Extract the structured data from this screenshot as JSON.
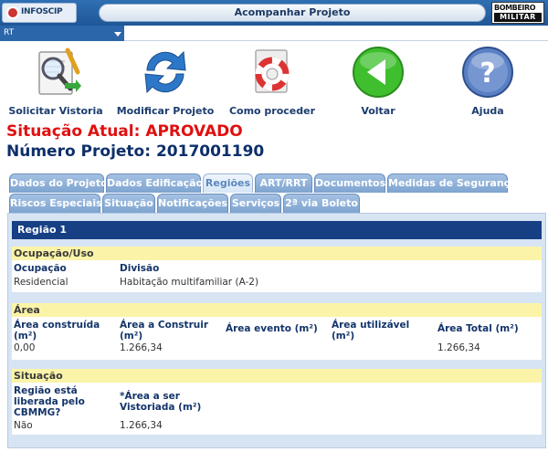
{
  "header": {
    "title": "Acompanhar Projeto",
    "logo_left": "INFOSCIP",
    "logo_right_top": "BOMBEIRO",
    "logo_right_bottom": "MILITAR"
  },
  "selector": {
    "value": "RT"
  },
  "toolbar": [
    {
      "label": "Solicitar Vistoria",
      "icon": "inspection-icon"
    },
    {
      "label": "Modificar Projeto",
      "icon": "refresh-arrows-icon"
    },
    {
      "label": "Como proceder",
      "icon": "lifebuoy-icon"
    },
    {
      "label": "Voltar",
      "icon": "back-arrow-icon"
    },
    {
      "label": "Ajuda",
      "icon": "help-icon"
    }
  ],
  "status": {
    "text": "Situação Atual: APROVADO"
  },
  "project": {
    "text": "Número Projeto: 2017001190"
  },
  "tabs_row1": [
    {
      "label": "Dados do Projeto",
      "active": false
    },
    {
      "label": "Dados Edificação",
      "active": false
    },
    {
      "label": "Regiões",
      "active": true
    },
    {
      "label": "ART/RRT",
      "active": false
    },
    {
      "label": "Documentos",
      "active": false
    },
    {
      "label": "Medidas de Segurança",
      "active": false
    }
  ],
  "tabs_row2": [
    {
      "label": "Riscos Especiais",
      "active": false
    },
    {
      "label": "Situação",
      "active": false
    },
    {
      "label": "Notificações",
      "active": false
    },
    {
      "label": "Serviços",
      "active": false
    },
    {
      "label": "2ª via Boleto",
      "active": false
    }
  ],
  "region": {
    "title": "Região 1",
    "ocupacao": {
      "heading": "Ocupação/Uso",
      "fields": [
        {
          "label": "Ocupação",
          "value": "Residencial"
        },
        {
          "label": "Divisão",
          "value": "Habitação multifamiliar (A-2)"
        }
      ]
    },
    "area": {
      "heading": "Área",
      "fields": [
        {
          "label": "Área construída (m²)",
          "value": "0,00"
        },
        {
          "label": "Área a Construir (m²)",
          "value": "1.266,34"
        },
        {
          "label": "Área evento (m²)",
          "value": ""
        },
        {
          "label": "Área utilizável (m²)",
          "value": ""
        },
        {
          "label": "Área Total (m²)",
          "value": "1.266,34"
        }
      ]
    },
    "situacao": {
      "heading": "Situação",
      "fields": [
        {
          "label": "Região está liberada pelo CBMMG?",
          "value": "Não"
        },
        {
          "label": "*Área a ser Vistoriada (m²)",
          "value": "1.266,34"
        }
      ]
    }
  },
  "colors": {
    "header_blue": "#1f5697",
    "status_red": "#e01010",
    "project_navy": "#0d2f6a",
    "region_bar": "#163f84",
    "section_yellow": "#fbf4a8"
  }
}
